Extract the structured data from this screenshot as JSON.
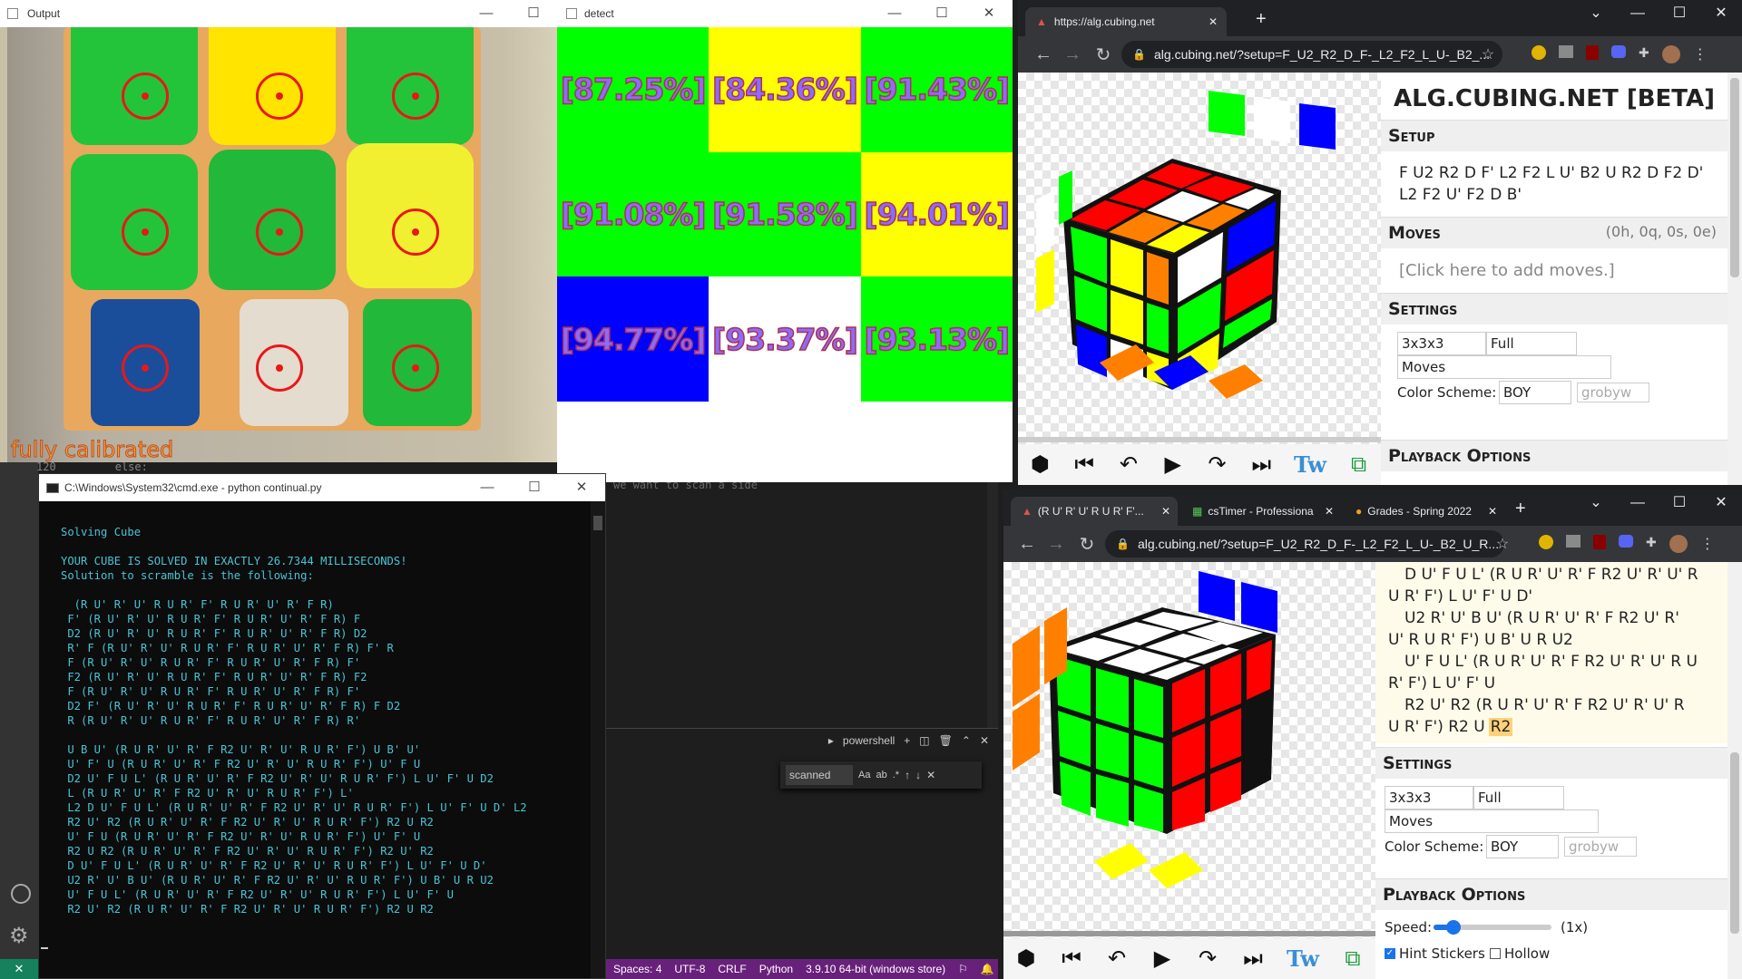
{
  "output_window": {
    "title": "Output",
    "status_text": "fully calibrated"
  },
  "detect_window": {
    "title": "detect",
    "cells": [
      "[87.25%]",
      "[84.36%]",
      "[91.43%]",
      "[91.08%]",
      "[91.58%]",
      "[94.01%]",
      "[94.77%]",
      "[93.37%]",
      "[93.13%]"
    ],
    "cell_colors": [
      "#00ff00",
      "#ffff00",
      "#00ff00",
      "#00ff00",
      "#00ff00",
      "#ffff00",
      "#0000ff",
      "#ffffff",
      "#00ff00"
    ]
  },
  "cmd_window": {
    "title": "C:\\Windows\\System32\\cmd.exe - python  continual.py",
    "lines": [
      "",
      "Solving Cube",
      "",
      "YOUR CUBE IS SOLVED IN EXACTLY 26.7344 MILLISECONDS!",
      "Solution to scramble is the following:",
      "",
      "  (R U' R' U' R U R' F' R U R' U' R' F R)",
      " F' (R U' R' U' R U R' F' R U R' U' R' F R) F",
      " D2 (R U' R' U' R U R' F' R U R' U' R' F R) D2",
      " R' F (R U' R' U' R U R' F' R U R' U' R' F R) F' R",
      " F (R U' R' U' R U R' F' R U R' U' R' F R) F'",
      " F2 (R U' R' U' R U R' F' R U R' U' R' F R) F2",
      " F (R U' R' U' R U R' F' R U R' U' R' F R) F'",
      " D2 F' (R U' R' U' R U R' F' R U R' U' R' F R) F D2",
      " R (R U' R' U' R U R' F' R U R' U' R' F R) R'",
      "",
      " U B U' (R U R' U' R' F R2 U' R' U' R U R' F') U B' U'",
      " U' F' U (R U R' U' R' F R2 U' R' U' R U R' F') U' F U",
      " D2 U' F U L' (R U R' U' R' F R2 U' R' U' R U R' F') L U' F' U D2",
      " L (R U R' U' R' F R2 U' R' U' R U R' F') L'",
      " L2 D U' F U L' (R U R' U' R' F R2 U' R' U' R U R' F') L U' F' U D' L2",
      " R2 U' R2 (R U R' U' R' F R2 U' R' U' R U R' F') R2 U R2",
      " U' F U (R U R' U' R' F R2 U' R' U' R U R' F') U' F' U",
      " R2 U R2 (R U R' U' R' F R2 U' R' U' R U R' F') R2 U' R2",
      " D U' F U L' (R U R' U' R' F R2 U' R' U' R U R' F') L U' F' U D'",
      " U2 R' U' B U' (R U R' U' R' F R2 U' R' U' R U R' F') U B' U R U2",
      " U' F U L' (R U R' U' R' F R2 U' R' U' R U R' F') L U' F' U",
      " R2 U' R2 (R U R' U' R' F R2 U' R' U' R U R' F') R2 U R2"
    ]
  },
  "vscode": {
    "code_line": "120         else:",
    "comment_line": "we want to scan a side",
    "terminal_label": "powershell",
    "find_value": "scanned",
    "status": {
      "spaces": "Spaces: 4",
      "encoding": "UTF-8",
      "eol": "CRLF",
      "lang": "Python",
      "version": "3.9.10 64-bit (windows store)"
    }
  },
  "browser_top": {
    "tab_title": "https://alg.cubing.net",
    "url": "alg.cubing.net/?setup=F_U2_R2_D_F-_L2_F2_L_U-_B2_...",
    "site_title": "ALG.CUBING.NET [BETA]",
    "setup_label": "Setup",
    "setup_text": "F U2 R2 D F' L2 F2 L U' B2 U R2 D F2 D' L2 F2 U' F2 D B'",
    "moves_label": "Moves",
    "moves_stats": "(0h, 0q, 0s, 0e)",
    "moves_placeholder": "[Click here to add moves.]",
    "settings_label": "Settings",
    "puzzle": "3x3x3",
    "stage": "Full",
    "mode": "Moves",
    "color_scheme_label": "Color Scheme:",
    "color_scheme": "BOY",
    "color_scheme_placeholder": "grobyw",
    "playback_label": "Playback Options",
    "tw_logo": "Tw"
  },
  "browser_bottom": {
    "tabs": [
      "(R U' R' U' R U R' F'...",
      "csTimer - Professiona",
      "Grades - Spring 2022"
    ],
    "url": "alg.cubing.net/?setup=F_U2_R2_D_F-_L2_F2_L_U-_B2_U_R...",
    "moves_lines": [
      "D U' F U L' (R U R' U' R' F R2 U' R' U' R",
      "U R' F') L U' F' U D'",
      "U2 R' U' B U' (R U R' U' R' F R2 U' R'",
      "U' R U R' F') U B' U R U2",
      "U' F U L' (R U R' U' R' F R2 U' R' U' R U",
      "R' F') L U' F' U",
      "R2 U' R2 (R U R' U' R' F R2 U' R' U' R",
      "U R' F') R2 U"
    ],
    "highlight_move": "R2",
    "settings_label": "Settings",
    "puzzle": "3x3x3",
    "stage": "Full",
    "mode": "Moves",
    "color_scheme_label": "Color Scheme:",
    "color_scheme": "BOY",
    "color_scheme_placeholder": "grobyw",
    "playback_label": "Playback Options",
    "speed_label": "Speed:",
    "speed_value": "(1x)",
    "hint_label": "Hint Stickers",
    "hollow_label": "Hollow",
    "tw_logo": "Tw"
  }
}
